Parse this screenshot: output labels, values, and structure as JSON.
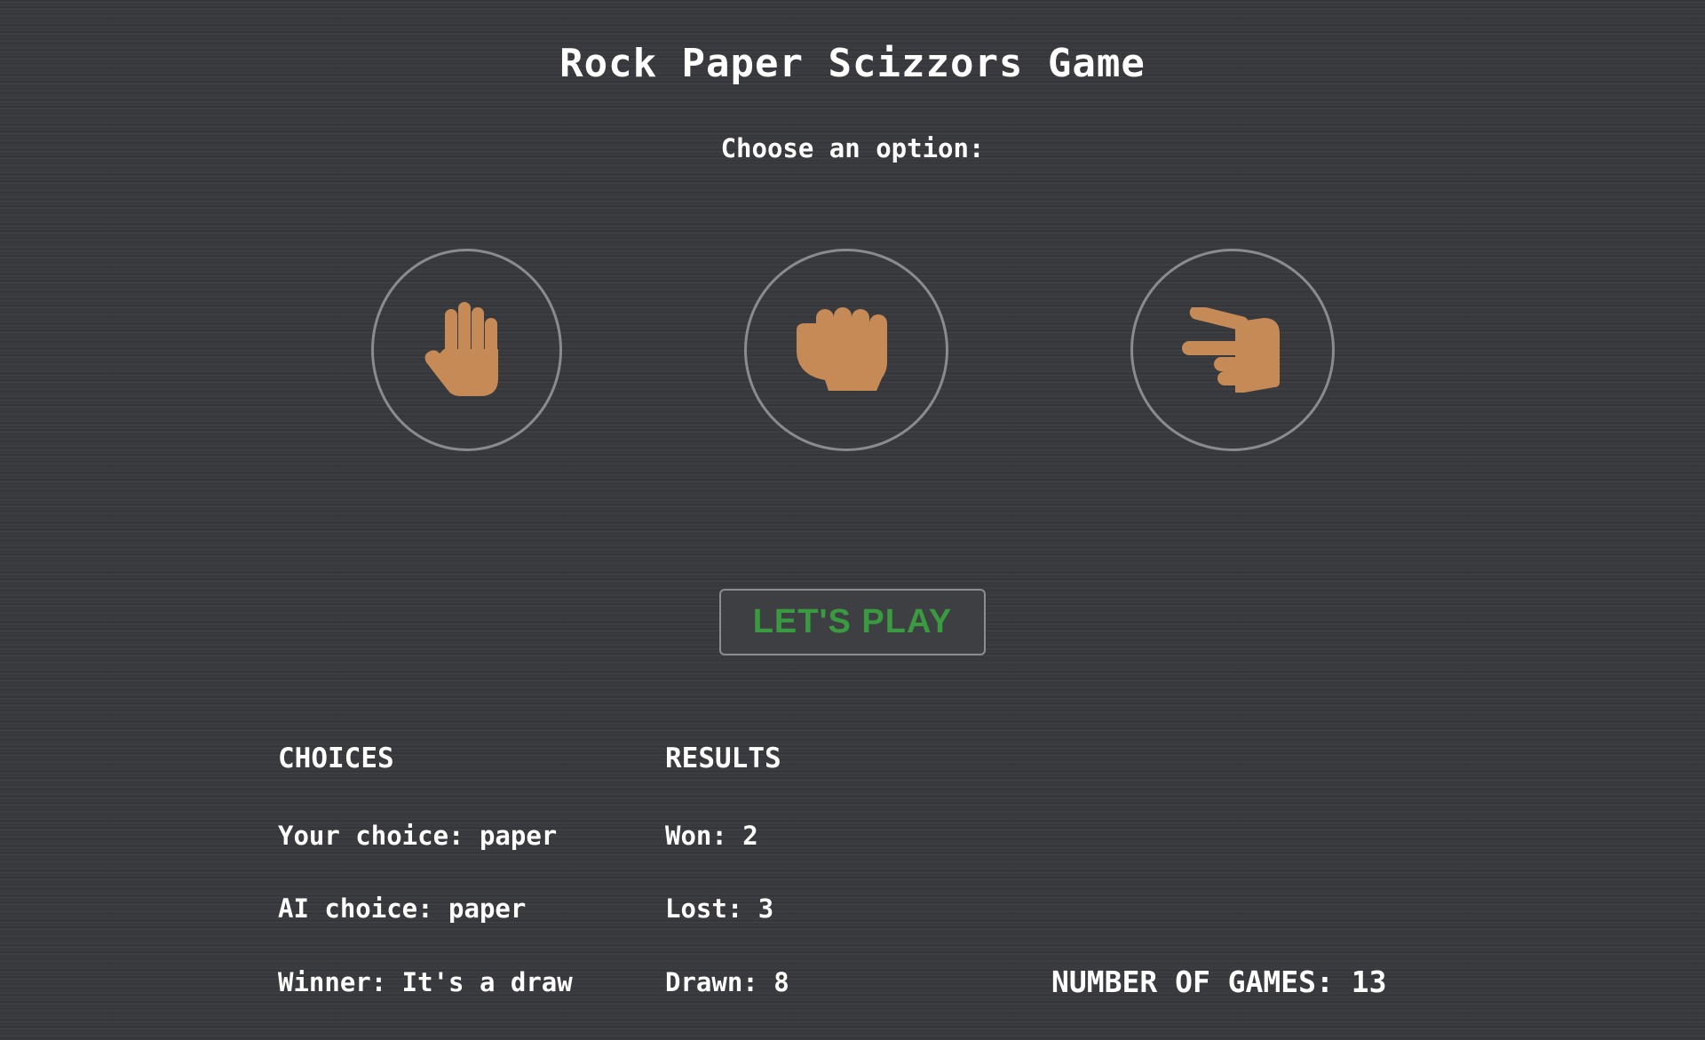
{
  "header": {
    "title": "Rock Paper Scizzors Game",
    "subtitle": "Choose an option:"
  },
  "options": [
    {
      "name": "paper",
      "icon": "raised-hand-icon"
    },
    {
      "name": "rock",
      "icon": "raised-fist-icon"
    },
    {
      "name": "scissors",
      "icon": "pointing-fingers-icon"
    }
  ],
  "colors": {
    "background": "#38393d",
    "hand": "#c68a56",
    "play_text": "#3a9a40",
    "ring": "#8a8b8e"
  },
  "play_button": {
    "label": "LET'S PLAY"
  },
  "choices": {
    "heading": "CHOICES",
    "your_choice": "Your choice: paper",
    "ai_choice": "AI choice: paper",
    "winner": "Winner: It's a draw"
  },
  "results": {
    "heading": "RESULTS",
    "won": "Won: 2",
    "lost": "Lost: 3",
    "drawn": "Drawn: 8"
  },
  "games": {
    "label": "NUMBER OF GAMES: 13"
  }
}
